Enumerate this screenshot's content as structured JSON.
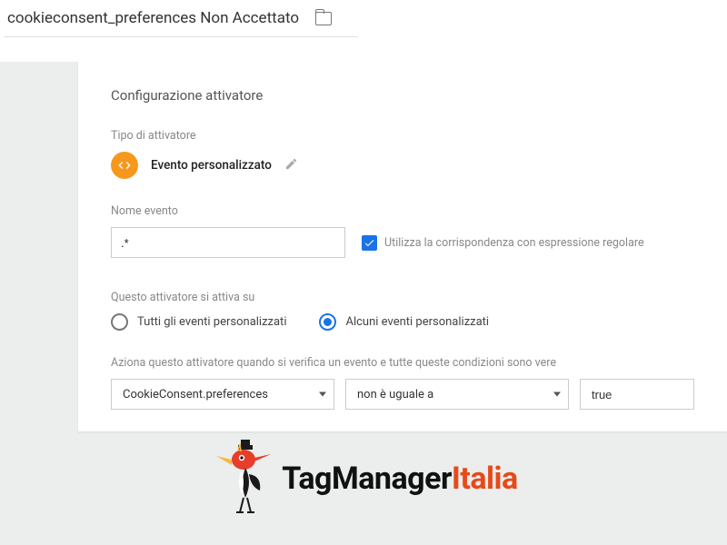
{
  "header": {
    "title": "cookieconsent_preferences Non Accettato"
  },
  "panel": {
    "title": "Configurazione attivatore",
    "trigger_type": {
      "label": "Tipo di attivatore",
      "value": "Evento personalizzato"
    },
    "event_name": {
      "label": "Nome evento",
      "value": ".*",
      "regex_checkbox_label": "Utilizza la corrispondenza con espressione regolare"
    },
    "fires_on": {
      "label": "Questo attivatore si attiva su",
      "options": {
        "all": "Tutti gli eventi personalizzati",
        "some": "Alcuni eventi personalizzati"
      }
    },
    "condition": {
      "label": "Aziona questo attivatore quando si verifica un evento e tutte queste condizioni sono vere",
      "variable": "CookieConsent.preferences",
      "operator": "non è uguale a",
      "value": "true"
    }
  },
  "logo": {
    "tag": "TagManager",
    "italia": "Italia"
  }
}
